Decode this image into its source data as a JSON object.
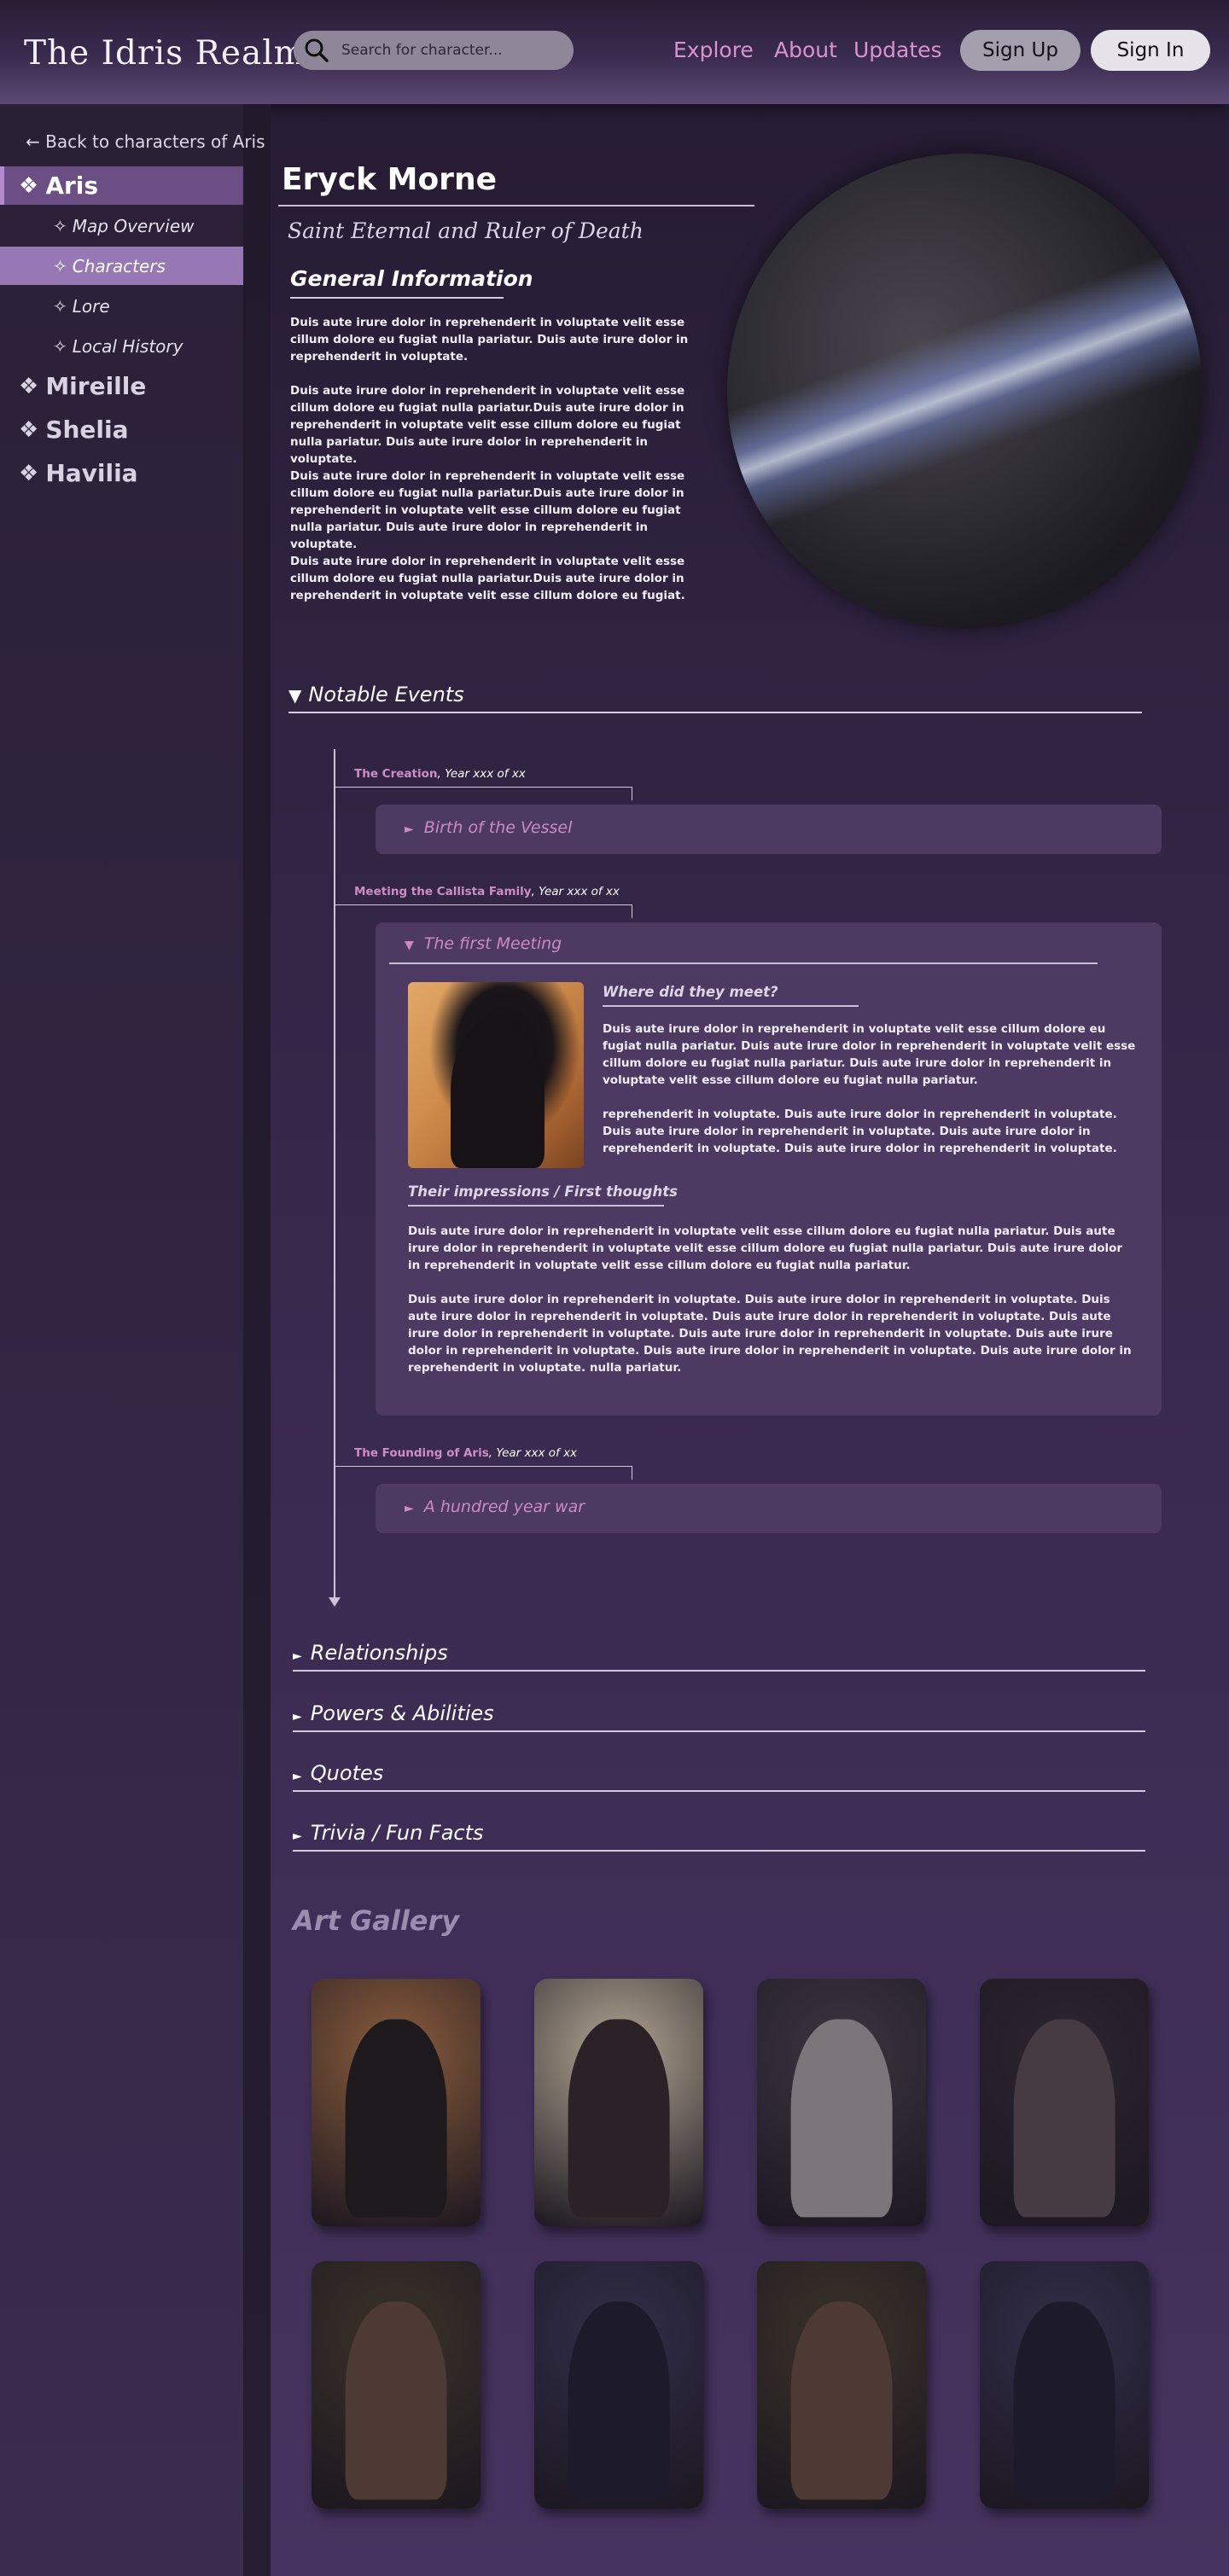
{
  "header": {
    "logo": "The Idris Realm",
    "search_placeholder": "Search for character...",
    "nav": [
      "Explore",
      "About",
      "Updates"
    ],
    "sign_up": "Sign Up",
    "sign_in": "Sign In"
  },
  "sidebar": {
    "back_link": "← Back to characters of Aris",
    "regions": [
      {
        "label": "Aris",
        "glyph": "❖"
      },
      {
        "label": "Mireille",
        "glyph": "❖"
      },
      {
        "label": "Shelia",
        "glyph": "❖"
      },
      {
        "label": "Havilia",
        "glyph": "❖"
      }
    ],
    "sub_items": [
      {
        "label": "Map Overview",
        "glyph": "✧"
      },
      {
        "label": "Characters",
        "glyph": "✧"
      },
      {
        "label": "Lore",
        "glyph": "✧"
      },
      {
        "label": "Local History",
        "glyph": "✧"
      }
    ]
  },
  "character": {
    "name": "Eryck Morne",
    "title": "Saint Eternal and Ruler of Death"
  },
  "general_info": {
    "heading": "General Information",
    "paragraphs": [
      "Duis aute irure dolor in reprehenderit in voluptate velit esse cillum dolore eu fugiat nulla pariatur. Duis aute irure dolor in reprehenderit in voluptate.",
      "Duis aute irure dolor in reprehenderit in voluptate velit esse cillum dolore eu fugiat nulla pariatur.Duis aute irure dolor in reprehenderit in voluptate velit esse cillum dolore eu fugiat nulla pariatur. Duis aute irure dolor in reprehenderit in voluptate.",
      "Duis aute irure dolor in reprehenderit in voluptate velit esse cillum dolore eu fugiat nulla pariatur.Duis aute irure dolor in reprehenderit in voluptate velit esse cillum dolore eu fugiat nulla pariatur. Duis aute irure dolor in reprehenderit in voluptate.",
      "Duis aute irure dolor in reprehenderit in voluptate velit esse cillum dolore eu fugiat nulla pariatur.Duis aute irure dolor in reprehenderit in voluptate velit esse cillum dolore eu fugiat."
    ]
  },
  "notable_events": {
    "heading": "Notable Events",
    "events": [
      {
        "label": "The Creation",
        "year": ", Year xxx of xx",
        "title": "Birth of the Vessel"
      },
      {
        "label": "Meeting the Callista Family",
        "year": ", Year xxx of xx",
        "title": "The first Meeting",
        "q1": "Where did they meet?",
        "q1_paras": [
          "Duis aute irure dolor in reprehenderit in voluptate velit esse cillum dolore eu fugiat nulla pariatur. Duis aute irure dolor in reprehenderit in voluptate velit esse cillum dolore eu fugiat nulla pariatur. Duis aute irure dolor in reprehenderit in voluptate velit esse cillum dolore eu fugiat nulla pariatur.",
          "reprehenderit in voluptate. Duis aute irure dolor in reprehenderit in voluptate. Duis aute irure dolor in reprehenderit in voluptate. Duis aute irure dolor in reprehenderit in voluptate. Duis aute irure dolor in reprehenderit in voluptate."
        ],
        "q2": "Their impressions / First thoughts",
        "q2_paras": [
          "Duis aute irure dolor in reprehenderit in voluptate velit esse cillum dolore eu fugiat nulla pariatur. Duis aute irure dolor in reprehenderit in voluptate velit esse cillum dolore eu fugiat nulla pariatur. Duis aute irure dolor in reprehenderit in voluptate velit esse cillum dolore eu fugiat nulla pariatur.",
          "Duis aute irure dolor in reprehenderit in voluptate. Duis aute irure dolor in reprehenderit in voluptate. Duis aute irure dolor in reprehenderit in voluptate.  Duis aute irure dolor in reprehenderit in voluptate. Duis aute irure dolor in reprehenderit in voluptate. Duis aute irure dolor in reprehenderit in voluptate.  Duis aute irure dolor in reprehenderit in voluptate. Duis aute irure dolor in reprehenderit in voluptate. Duis aute irure dolor in reprehenderit in voluptate. nulla pariatur."
        ]
      },
      {
        "label": "The Founding of Aris",
        "year": ", Year xxx of xx",
        "title": "A hundred year war"
      }
    ]
  },
  "sections": [
    "Relationships",
    "Powers & Abilities",
    "Quotes",
    "Trivia / Fun Facts"
  ],
  "gallery": {
    "title": "Art Gallery",
    "items": [
      {
        "bg": "#8a5c3c",
        "fig": "#1d191c"
      },
      {
        "bg": "#b1a592",
        "fig": "#2a2226"
      },
      {
        "bg": "#3c3540",
        "fig": "#7c7579"
      },
      {
        "bg": "#2d2430",
        "fig": "#463b43"
      },
      {
        "bg": "#3a3228",
        "fig": "#4d3a35"
      },
      {
        "bg": "#312e4a",
        "fig": "#1d1a2b"
      },
      {
        "bg": "#3a3228",
        "fig": "#4d3a35"
      },
      {
        "bg": "#312e4a",
        "fig": "#1d1a2b"
      }
    ]
  },
  "colors": {
    "accent": "#cf8dc6",
    "active_region": "#6a4e84",
    "active_sub": "#9679b4",
    "card": "#4d3a62"
  }
}
